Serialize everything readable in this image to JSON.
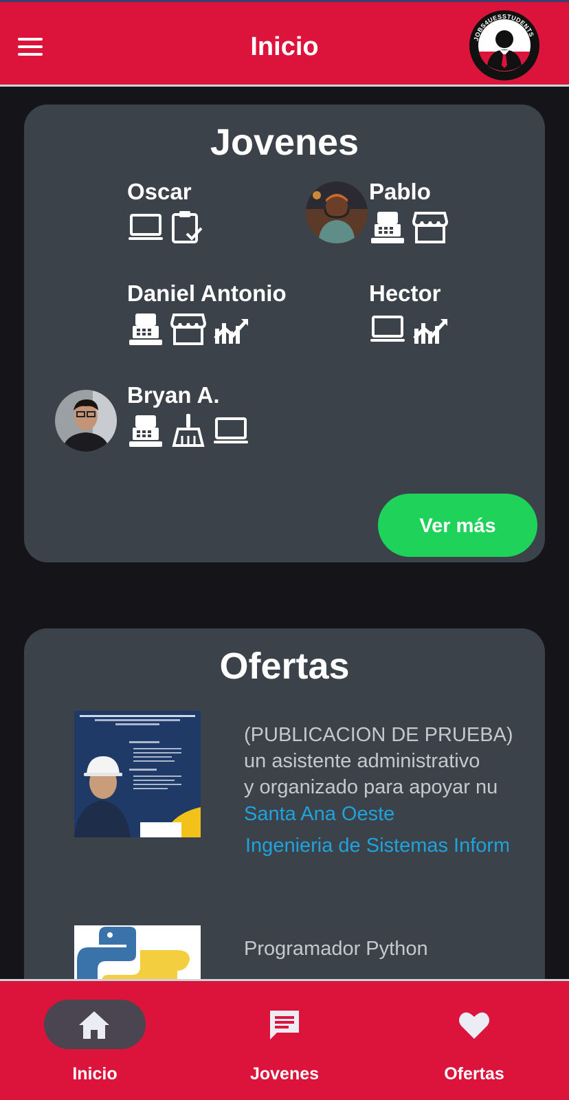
{
  "header": {
    "title": "Inicio",
    "menu_icon": "hamburger-menu-icon",
    "logo_text": "JOBS4UESSTUDENTS",
    "bar_color": "#dc143c"
  },
  "jovenes": {
    "title": "Jovenes",
    "people": [
      {
        "name": "Oscar",
        "icons": [
          "laptop-icon",
          "clipboard-check-icon"
        ],
        "has_avatar": false
      },
      {
        "name": "Pablo",
        "icons": [
          "cash-register-icon",
          "store-icon"
        ],
        "has_avatar": true
      },
      {
        "name": "Daniel Antonio",
        "icons": [
          "cash-register-icon",
          "store-icon",
          "chart-icon"
        ],
        "has_avatar": false
      },
      {
        "name": "Hector",
        "icons": [
          "laptop-icon",
          "chart-icon"
        ],
        "has_avatar": false
      },
      {
        "name": "Bryan A.",
        "icons": [
          "cash-register-icon",
          "broom-icon",
          "laptop-icon"
        ],
        "has_avatar": true
      }
    ],
    "more_button": "Ver más",
    "button_color": "#1ed25a"
  },
  "ofertas": {
    "title": "Ofertas",
    "items": [
      {
        "lines": [
          "(PUBLICACION DE PRUEBA)",
          "un asistente administrativo",
          "y organizado para apoyar nu"
        ],
        "location": "Santa Ana Oeste",
        "career": "Ingenieria de Sistemas Informaticos"
      },
      {
        "lines": [
          "Programador Python"
        ]
      }
    ]
  },
  "bottom_nav": {
    "items": [
      {
        "label": "Inicio",
        "icon": "home-icon",
        "active": true
      },
      {
        "label": "Jovenes",
        "icon": "chat-icon",
        "active": false
      },
      {
        "label": "Ofertas",
        "icon": "heart-icon",
        "active": false
      }
    ]
  }
}
